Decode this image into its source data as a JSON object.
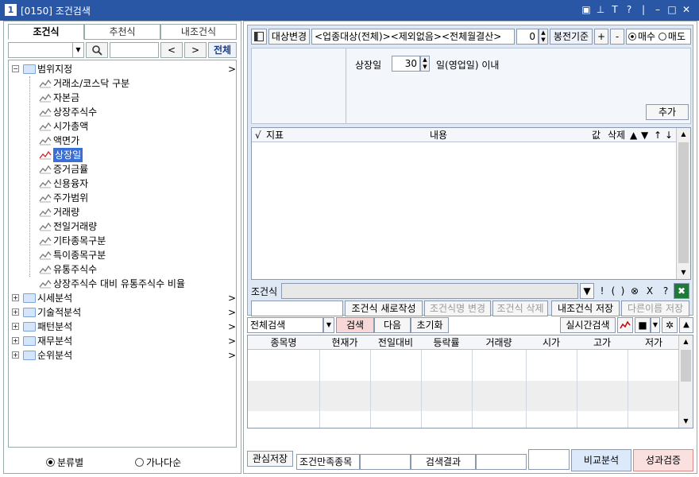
{
  "window": {
    "number": "1",
    "title": "[0150] 조건검색",
    "icons": [
      "window-icon",
      "pin-icon",
      "font-icon",
      "help-icon",
      "minimize-icon",
      "maximize-icon",
      "close-icon"
    ]
  },
  "left": {
    "tabs": [
      "조건식",
      "추천식",
      "내조건식"
    ],
    "search": {
      "all_label": "전체",
      "prev": "<",
      "next": ">"
    },
    "tree": [
      {
        "label": "범위지정",
        "level": 0,
        "type": "folder",
        "expanded": true,
        "more": ">"
      },
      {
        "label": "거래소/코스닥 구분",
        "level": 1,
        "type": "item"
      },
      {
        "label": "자본금",
        "level": 1,
        "type": "item"
      },
      {
        "label": "상장주식수",
        "level": 1,
        "type": "item"
      },
      {
        "label": "시가총액",
        "level": 1,
        "type": "item"
      },
      {
        "label": "액면가",
        "level": 1,
        "type": "item"
      },
      {
        "label": "상장일",
        "level": 1,
        "type": "item",
        "selected": true
      },
      {
        "label": "증거금률",
        "level": 1,
        "type": "item"
      },
      {
        "label": "신용융자",
        "level": 1,
        "type": "item"
      },
      {
        "label": "주가범위",
        "level": 1,
        "type": "item"
      },
      {
        "label": "거래량",
        "level": 1,
        "type": "item"
      },
      {
        "label": "전일거래량",
        "level": 1,
        "type": "item"
      },
      {
        "label": "기타종목구분",
        "level": 1,
        "type": "item"
      },
      {
        "label": "특이종목구분",
        "level": 1,
        "type": "item"
      },
      {
        "label": "유통주식수",
        "level": 1,
        "type": "item"
      },
      {
        "label": "상장주식수 대비 유통주식수 비율",
        "level": 1,
        "type": "item"
      },
      {
        "label": "시세분석",
        "level": 0,
        "type": "folder",
        "expanded": false,
        "more": ">"
      },
      {
        "label": "기술적분석",
        "level": 0,
        "type": "folder",
        "expanded": false,
        "more": ">"
      },
      {
        "label": "패턴분석",
        "level": 0,
        "type": "folder",
        "expanded": false,
        "more": ">"
      },
      {
        "label": "재무분석",
        "level": 0,
        "type": "folder",
        "expanded": false,
        "more": ">"
      },
      {
        "label": "순위분석",
        "level": 0,
        "type": "folder",
        "expanded": false,
        "more": ">"
      }
    ],
    "radios": [
      {
        "label": "분류별",
        "checked": true
      },
      {
        "label": "가나다순",
        "checked": false
      }
    ]
  },
  "toolbar": {
    "target_change": "대상변경",
    "target_text": "<업종대상(전체)><제외없음><전체월결산>",
    "bong_value": "0",
    "bong_label": "봉전기준",
    "plus": "+",
    "minus": "-",
    "buy_label": "매수",
    "sell_label": "매도"
  },
  "param": {
    "label": "상장일",
    "value": "30",
    "suffix": "일(영업일) 이내",
    "add_button": "추가"
  },
  "cond_grid": {
    "headers": [
      "√",
      "지표",
      "내용",
      "값",
      "삭제",
      "▲",
      "▼",
      "↑",
      "↓"
    ]
  },
  "formula": {
    "label": "조건식",
    "ops": [
      "!",
      "(",
      ")",
      "⊗",
      "X",
      "?"
    ]
  },
  "actions": {
    "new_formula": "조건식 새로작성",
    "rename": "조건식명 변경",
    "delete": "조건식 삭제",
    "save_my": "내조건식 저장",
    "save_as": "다른이름 저장"
  },
  "search_bar": {
    "scope": "전체검색",
    "search": "검색",
    "next": "다음",
    "reset": "초기화",
    "realtime": "실시간검색"
  },
  "result_grid": {
    "headers": [
      "종목명",
      "현재가",
      "전일대비",
      "등락률",
      "거래량",
      "시가",
      "고가",
      "저가"
    ]
  },
  "bottom": {
    "watch_save": "관심저장",
    "cond_match": "조건만족종목",
    "result_label": "검색결과",
    "compare": "비교분석",
    "perf": "성과검증"
  },
  "colors": {
    "titlebar": "#2a56a6",
    "panel": "#dfe8f5",
    "search_button": "#f8d7d7",
    "compare_button": "#dbe9fb",
    "perf_button": "#fbe0e0",
    "selection": "#3a6fd8"
  }
}
